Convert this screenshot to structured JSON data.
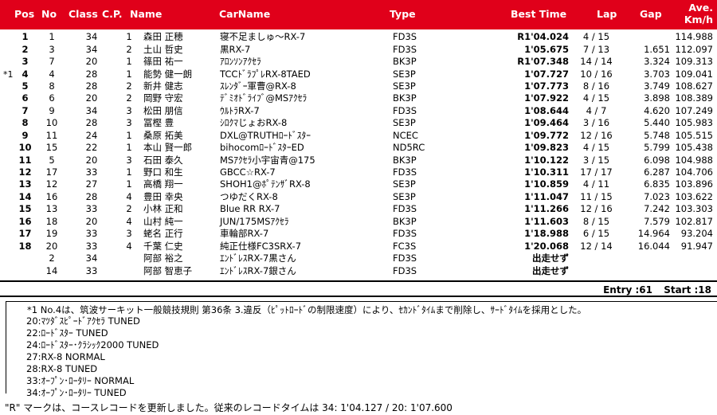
{
  "header": {
    "pos": "Pos",
    "no": "No",
    "class": "Class",
    "cp": "C.P.",
    "name": "Name",
    "carname": "CarName",
    "type": "Type",
    "best_time": "Best Time",
    "lap": "Lap",
    "gap": "Gap",
    "ave_line1": "Ave.",
    "ave_line2": "Km/h"
  },
  "rows": [
    {
      "mark": "",
      "pos": "1",
      "no": "1",
      "class": "34",
      "cp": "1",
      "name": "森田 正穂",
      "car": "寝不足ましゅ～RX-7",
      "type": "FD3S",
      "best": "R1'04.024",
      "lap": "4 / 15",
      "gap": "",
      "ave": "114.988"
    },
    {
      "mark": "",
      "pos": "2",
      "no": "3",
      "class": "34",
      "cp": "2",
      "name": "土山 哲史",
      "car": "黒RX-7",
      "type": "FD3S",
      "best": "1'05.675",
      "lap": "7 / 13",
      "gap": "1.651",
      "ave": "112.097"
    },
    {
      "mark": "",
      "pos": "3",
      "no": "7",
      "class": "20",
      "cp": "1",
      "name": "篠田 祐一",
      "car": "ｱﾛﾝｿﾝｱｸｾﾗ",
      "type": "BK3P",
      "best": "R1'07.348",
      "lap": "14 / 14",
      "gap": "3.324",
      "ave": "109.313"
    },
    {
      "mark": "*1",
      "pos": "4",
      "no": "4",
      "class": "28",
      "cp": "1",
      "name": "能勢 健一朗",
      "car": "TCCﾄﾞﾗﾌﾟﾚRX-8TAED",
      "type": "SE3P",
      "best": "1'07.727",
      "lap": "10 / 16",
      "gap": "3.703",
      "ave": "109.041"
    },
    {
      "mark": "",
      "pos": "5",
      "no": "8",
      "class": "28",
      "cp": "2",
      "name": "新井 健志",
      "car": "ｽﾚﾝﾀﾞｰ軍曹@RX-8",
      "type": "SE3P",
      "best": "1'07.773",
      "lap": "8 / 16",
      "gap": "3.749",
      "ave": "108.627"
    },
    {
      "mark": "",
      "pos": "6",
      "no": "6",
      "class": "20",
      "cp": "2",
      "name": "岡野 守宏",
      "car": "ﾃﾞﾐｵﾄﾞﾗｲﾌﾞ@MSｱｸｾﾗ",
      "type": "BK3P",
      "best": "1'07.922",
      "lap": "4 / 15",
      "gap": "3.898",
      "ave": "108.389"
    },
    {
      "mark": "",
      "pos": "7",
      "no": "9",
      "class": "34",
      "cp": "3",
      "name": "松田 朋信",
      "car": "ｳﾙﾄﾗRX-7",
      "type": "FD3S",
      "best": "1'08.644",
      "lap": "4 / 7",
      "gap": "4.620",
      "ave": "107.249"
    },
    {
      "mark": "",
      "pos": "8",
      "no": "10",
      "class": "28",
      "cp": "3",
      "name": "冨樫 豊",
      "car": "ｼﾛｸﾏじょおRX-8",
      "type": "SE3P",
      "best": "1'09.464",
      "lap": "3 / 16",
      "gap": "5.440",
      "ave": "105.983"
    },
    {
      "mark": "",
      "pos": "9",
      "no": "11",
      "class": "24",
      "cp": "1",
      "name": "桑原 拓美",
      "car": "DXL@TRUTHﾛｰﾄﾞｽﾀｰ",
      "type": "NCEC",
      "best": "1'09.772",
      "lap": "12 / 16",
      "gap": "5.748",
      "ave": "105.515"
    },
    {
      "mark": "",
      "pos": "10",
      "no": "15",
      "class": "22",
      "cp": "1",
      "name": "本山 賢一郎",
      "car": "bihocomﾛｰﾄﾞｽﾀｰED",
      "type": "ND5RC",
      "best": "1'09.823",
      "lap": "4 / 15",
      "gap": "5.799",
      "ave": "105.438"
    },
    {
      "mark": "",
      "pos": "11",
      "no": "5",
      "class": "20",
      "cp": "3",
      "name": "石田 泰久",
      "car": "MSｱｸｾﾗ小宇宙青@175",
      "type": "BK3P",
      "best": "1'10.122",
      "lap": "3 / 15",
      "gap": "6.098",
      "ave": "104.988"
    },
    {
      "mark": "",
      "pos": "12",
      "no": "17",
      "class": "33",
      "cp": "1",
      "name": "野口 和生",
      "car": "GBCC☆RX-7",
      "type": "FD3S",
      "best": "1'10.311",
      "lap": "17 / 17",
      "gap": "6.287",
      "ave": "104.706"
    },
    {
      "mark": "",
      "pos": "13",
      "no": "12",
      "class": "27",
      "cp": "1",
      "name": "高橋 翔一",
      "car": "SHOH1@ﾎﾟﾃﾝｻﾞRX-8",
      "type": "SE3P",
      "best": "1'10.859",
      "lap": "4 / 11",
      "gap": "6.835",
      "ave": "103.896"
    },
    {
      "mark": "",
      "pos": "14",
      "no": "16",
      "class": "28",
      "cp": "4",
      "name": "豊田 幸央",
      "car": "つゆだくRX-8",
      "type": "SE3P",
      "best": "1'11.047",
      "lap": "11 / 15",
      "gap": "7.023",
      "ave": "103.622"
    },
    {
      "mark": "",
      "pos": "15",
      "no": "13",
      "class": "33",
      "cp": "2",
      "name": "小林 正和",
      "car": "Blue RR RX-7",
      "type": "FD3S",
      "best": "1'11.266",
      "lap": "12 / 16",
      "gap": "7.242",
      "ave": "103.303"
    },
    {
      "mark": "",
      "pos": "16",
      "no": "18",
      "class": "20",
      "cp": "4",
      "name": "山村 純一",
      "car": "JUN/175MSｱｸｾﾗ",
      "type": "BK3P",
      "best": "1'11.603",
      "lap": "8 / 15",
      "gap": "7.579",
      "ave": "102.817"
    },
    {
      "mark": "",
      "pos": "17",
      "no": "19",
      "class": "33",
      "cp": "3",
      "name": "蛯名 正行",
      "car": "車輪部RX-7",
      "type": "FD3S",
      "best": "1'18.988",
      "lap": "6 / 15",
      "gap": "14.964",
      "ave": "93.204"
    },
    {
      "mark": "",
      "pos": "18",
      "no": "20",
      "class": "33",
      "cp": "4",
      "name": "千葉 仁史",
      "car": "純正仕様FC3SRX-7",
      "type": "FC3S",
      "best": "1'20.068",
      "lap": "12 / 14",
      "gap": "16.044",
      "ave": "91.947"
    },
    {
      "mark": "",
      "pos": "",
      "no": "2",
      "class": "34",
      "cp": "",
      "name": "阿部 裕之",
      "car": "ｴﾝﾄﾞﾚｽRX-7黒さん",
      "type": "FD3S",
      "best": "出走せず",
      "lap": "",
      "gap": "",
      "ave": ""
    },
    {
      "mark": "",
      "pos": "",
      "no": "14",
      "class": "33",
      "cp": "",
      "name": "阿部 智恵子",
      "car": "ｴﾝﾄﾞﾚｽRX-7銀さん",
      "type": "FD3S",
      "best": "出走せず",
      "lap": "",
      "gap": "",
      "ave": ""
    }
  ],
  "summary": {
    "entry": "Entry :61",
    "start": "Start :18"
  },
  "notes": [
    "*1 No.4は、筑波サーキット一般競技規則 第36条 3.違反（ﾋﾟｯﾄﾛｰﾄﾞの制限速度）により、ｾｶﾝﾄﾞﾀｲﾑまで削除し、ｻｰﾄﾞﾀｲﾑを採用とした。",
    "20:ﾏﾂﾀﾞｽﾋﾟｰﾄﾞｱｸｾﾗ TUNED",
    "22:ﾛｰﾄﾞｽﾀｰ TUNED",
    "24:ﾛｰﾄﾞｽﾀｰ･ｸﾗｼｯｸ2000 TUNED",
    "27:RX-8 NORMAL",
    "28:RX-8 TUNED",
    "33:ｵｰﾌﾟﾝ･ﾛｰﾀﾘｰ NORMAL",
    "34:ｵｰﾌﾟﾝ･ﾛｰﾀﾘｰ TUNED"
  ],
  "footer": "\"R\" マークは、コースレコードを更新しました。従来のレコードタイムは 34: 1'04.127 / 20: 1'07.600"
}
